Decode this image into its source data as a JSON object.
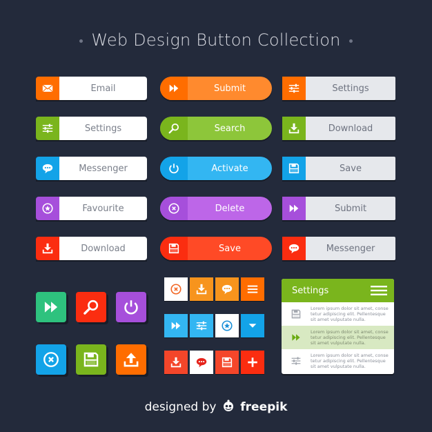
{
  "title": "Web Design Button Collection",
  "colors": {
    "background": "#232a3b",
    "orange": "#ff6d00",
    "green": "#7ab51d",
    "blue": "#13a3e8",
    "purple": "#a64fdb",
    "red": "#fb2d10"
  },
  "column1": [
    {
      "label": "Email",
      "icon": "envelope-icon",
      "color": "#ff6d00"
    },
    {
      "label": "Settings",
      "icon": "sliders-icon",
      "color": "#7ab51d"
    },
    {
      "label": "Messenger",
      "icon": "chat-bubble-icon",
      "color": "#13a3e8"
    },
    {
      "label": "Favourite",
      "icon": "star-circle-icon",
      "color": "#a64fdb"
    },
    {
      "label": "Download",
      "icon": "download-icon",
      "color": "#fb2d10"
    }
  ],
  "column2": [
    {
      "label": "Submit",
      "icon": "fast-forward-icon",
      "color": "#ff6d00",
      "light": "#ff8a2e"
    },
    {
      "label": "Search",
      "icon": "magnifier-icon",
      "color": "#7ab51d",
      "light": "#8dc63a"
    },
    {
      "label": "Activate",
      "icon": "power-icon",
      "color": "#13a3e8",
      "light": "#33b6f2"
    },
    {
      "label": "Delete",
      "icon": "close-circle-icon",
      "color": "#a64fdb",
      "light": "#bd66e8"
    },
    {
      "label": "Save",
      "icon": "floppy-disk-icon",
      "color": "#fb2d10",
      "light": "#ff4a26"
    }
  ],
  "column3": [
    {
      "label": "Settings",
      "icon": "sliders-icon",
      "color": "#ff6d00"
    },
    {
      "label": "Download",
      "icon": "download-icon",
      "color": "#7ab51d"
    },
    {
      "label": "Save",
      "icon": "floppy-disk-icon",
      "color": "#13a3e8"
    },
    {
      "label": "Submit",
      "icon": "fast-forward-icon",
      "color": "#a64fdb"
    },
    {
      "label": "Messenger",
      "icon": "chat-bubble-icon",
      "color": "#fb2d10"
    }
  ],
  "square_buttons": [
    {
      "icon": "fast-forward-icon",
      "color": "#2ec27e"
    },
    {
      "icon": "magnifier-icon",
      "color": "#fb2d10"
    },
    {
      "icon": "power-icon",
      "color": "#a64fdb"
    },
    {
      "icon": "close-circle-icon",
      "color": "#13a3e8"
    },
    {
      "icon": "floppy-disk-icon",
      "color": "#7ab51d"
    },
    {
      "icon": "upload-icon",
      "color": "#ff6d00"
    }
  ],
  "tile_grid": [
    [
      {
        "icon": "close-circle-icon",
        "bg": "#ffffff",
        "fg": "#f26522"
      },
      {
        "icon": "download-icon",
        "bg": "#f7941d",
        "fg": "#ffffff"
      },
      {
        "icon": "chat-bubble-icon",
        "bg": "#f7941d",
        "fg": "#ffffff"
      },
      {
        "icon": "menu-icon",
        "bg": "#ff6d00",
        "fg": "#ffffff"
      }
    ],
    [
      {
        "icon": "fast-forward-icon",
        "bg": "#33b6f2",
        "fg": "#ffffff"
      },
      {
        "icon": "sliders-icon",
        "bg": "#33b6f2",
        "fg": "#ffffff"
      },
      {
        "icon": "star-circle-icon",
        "bg": "#ffffff",
        "fg": "#1a8fd8"
      },
      {
        "icon": "caret-down-icon",
        "bg": "#13a3e8",
        "fg": "#ffffff"
      }
    ],
    [
      {
        "icon": "download-icon",
        "bg": "#f4462a",
        "fg": "#ffffff"
      },
      {
        "icon": "chat-bubble-icon",
        "bg": "#ffffff",
        "fg": "#e5231b"
      },
      {
        "icon": "floppy-disk-icon",
        "bg": "#f4462a",
        "fg": "#ffffff"
      },
      {
        "icon": "plus-icon",
        "bg": "#fb2d10",
        "fg": "#ffffff"
      }
    ]
  ],
  "settings_panel": {
    "title": "Settings",
    "menu_icon": "menu-icon",
    "rows": [
      {
        "icon": "floppy-disk-icon",
        "text": "Lorem ipsum dolor sit amet, conse tetur adipiscing elit. Pellentesque sit amet vulputate nulla.",
        "selected": false
      },
      {
        "icon": "fast-forward-icon",
        "text": "Lorem ipsum dolor sit amet, conse tetur adipiscing elit. Pellentesque sit amet vulputate nulla.",
        "selected": true
      },
      {
        "icon": "sliders-icon",
        "text": "Lorem ipsum dolor sit amet, conse tetur adipiscing elit. Pellentesque sit amet vulputate nulla.",
        "selected": false
      }
    ]
  },
  "footer": {
    "prefix": "designed by",
    "brand": "freepik",
    "logo_icon": "freepik-logo-icon"
  }
}
